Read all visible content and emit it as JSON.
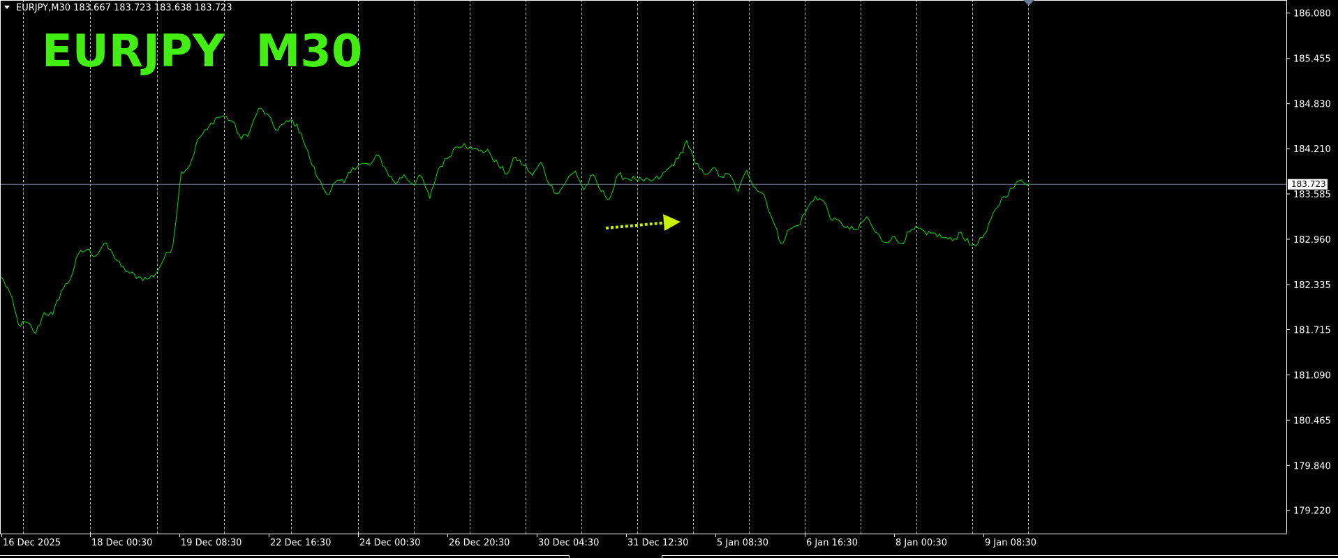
{
  "header": {
    "caret_icon": "triangle-down-icon",
    "symbol_line": "EURJPY,M30  183.667 183.723 183.638 183.723"
  },
  "watermark": {
    "text": "EURJPY  M30",
    "color": "#43ef13"
  },
  "colors": {
    "background": "#000000",
    "price_line": "#00e000",
    "grid": "#ffffff",
    "bid_line": "#6d7a99",
    "arrow": "#c8f000",
    "axis_text": "#ffffff"
  },
  "current_price_label": "183.723",
  "chart_data": {
    "type": "line",
    "title": "",
    "series": [
      {
        "values": [
          182.44,
          182.22,
          181.78,
          181.81,
          181.66,
          181.95,
          181.92,
          182.25,
          182.4,
          182.76,
          182.82,
          182.73,
          182.9,
          182.76,
          182.58,
          182.49,
          182.44,
          182.41,
          182.48,
          182.7,
          182.86,
          183.89,
          183.98,
          184.35,
          184.47,
          184.63,
          184.66,
          184.58,
          184.34,
          184.45,
          184.76,
          184.69,
          184.47,
          184.55,
          184.6,
          184.42,
          184.07,
          183.79,
          183.58,
          183.75,
          183.74,
          183.95,
          184.0,
          183.98,
          184.12,
          183.89,
          183.73,
          183.85,
          183.72,
          183.83,
          183.52,
          183.93,
          184.07,
          184.23,
          184.28,
          184.2,
          184.19,
          184.15,
          183.98,
          183.86,
          184.09,
          183.98,
          183.84,
          184.02,
          183.71,
          183.59,
          183.78,
          183.9,
          183.64,
          183.85,
          183.62,
          183.52,
          183.85,
          183.8,
          183.79,
          183.76,
          183.77,
          183.82,
          183.95,
          184.07,
          184.32,
          184.0,
          183.86,
          183.94,
          183.82,
          183.85,
          183.62,
          183.91,
          183.67,
          183.58,
          183.23,
          182.9,
          183.1,
          183.15,
          183.37,
          183.55,
          183.48,
          183.22,
          183.19,
          183.1,
          183.1,
          183.27,
          183.06,
          182.92,
          182.99,
          182.9,
          183.06,
          183.11,
          183.02,
          183.04,
          182.98,
          182.94,
          183.06,
          182.88,
          182.91,
          183.06,
          183.37,
          183.55,
          183.66,
          183.78,
          183.73
        ]
      }
    ],
    "ylim": [
      178.9,
      186.26
    ],
    "y_ticks": [
      "186.080",
      "185.455",
      "184.830",
      "184.210",
      "183.585",
      "182.960",
      "182.335",
      "181.715",
      "181.090",
      "180.465",
      "179.840",
      "179.220"
    ],
    "x_ticks": [
      "16 Dec 2025",
      "18 Dec 00:30",
      "19 Dec 08:30",
      "22 Dec 16:30",
      "24 Dec 00:30",
      "26 Dec 20:30",
      "30 Dec 04:30",
      "31 Dec 12:30",
      "5 Jan 08:30",
      "6 Jan 16:30",
      "8 Jan 00:30",
      "9 Jan 08:30"
    ],
    "current_price": 183.723,
    "grid": "vertical-dashed",
    "annotation": "dotted-arrow"
  }
}
